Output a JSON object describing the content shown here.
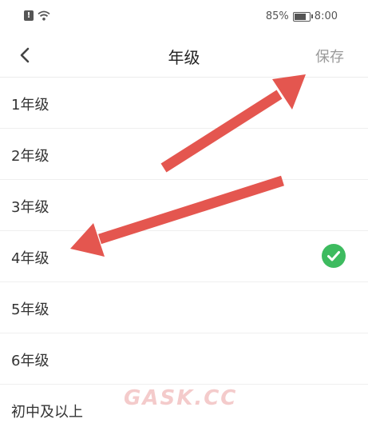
{
  "status_bar": {
    "battery": "85%",
    "time": "8:00",
    "icons": [
      "alert-icon",
      "wifi-icon",
      "battery-icon"
    ]
  },
  "header": {
    "title": "年级",
    "save_label": "保存",
    "back_icon": "chevron-left-icon"
  },
  "grades": [
    {
      "label": "1年级",
      "selected": false
    },
    {
      "label": "2年级",
      "selected": false
    },
    {
      "label": "3年级",
      "selected": false
    },
    {
      "label": "4年级",
      "selected": true
    },
    {
      "label": "5年级",
      "selected": false
    },
    {
      "label": "6年级",
      "selected": false
    },
    {
      "label": "初中及以上",
      "selected": false
    }
  ],
  "colors": {
    "accent_check": "#3dbb5f",
    "annotation_arrow": "#e4564f",
    "save_text": "#9a9a9a"
  },
  "watermark": "GASK.CC"
}
